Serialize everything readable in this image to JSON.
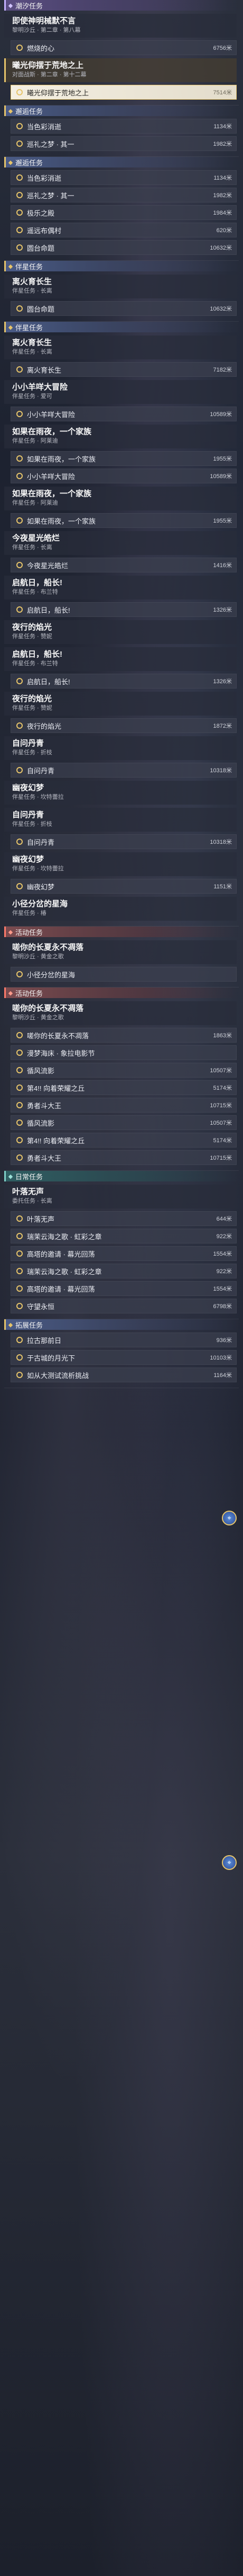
{
  "icons": {
    "category": "diamond-icon",
    "marker": "ring-marker-icon",
    "pin": "map-pin-icon"
  },
  "colors": {
    "accent": "#e6c46a",
    "current_step_bg": "#f4efe2",
    "highlight_cat": "#7b4b4f"
  },
  "sections": [
    {
      "category": "潮汐任务",
      "style": "story",
      "quests": [
        {
          "title": "即使神明械默不言",
          "sub": "黎明沙丘 · 第二章 · 第八幕",
          "tracked": false,
          "steps": [
            {
              "label": "燃烧的心",
              "dist": "6756米",
              "current": false
            }
          ]
        },
        {
          "title": "曦光仰摆于荒地之上",
          "sub": "对面战斯 · 第二章 · 第十二幕",
          "tracked": true,
          "steps": [
            {
              "label": "曦光仰摆于荒地之上",
              "dist": "7514米",
              "current": true
            }
          ]
        }
      ]
    },
    {
      "category": "邂逅任务",
      "style": "normal",
      "quests": [
        {
          "title": "",
          "sub": "",
          "tracked": false,
          "steps": [
            {
              "label": "当色彩消逝",
              "dist": "1134米",
              "current": false
            },
            {
              "label": "巡礼之梦 · 其一",
              "dist": "1982米",
              "current": false
            }
          ]
        }
      ]
    },
    {
      "category": "邂逅任务",
      "style": "normal",
      "quests": [
        {
          "title": "",
          "sub": "",
          "tracked": false,
          "steps": [
            {
              "label": "当色彩消逝",
              "dist": "1134米",
              "current": false
            },
            {
              "label": "巡礼之梦 · 其一",
              "dist": "1982米",
              "current": false
            },
            {
              "label": "极乐之殿",
              "dist": "1984米",
              "current": false
            },
            {
              "label": "遥远布偶村",
              "dist": "620米",
              "current": false
            },
            {
              "label": "圆台命题",
              "dist": "10632米",
              "current": false
            }
          ]
        }
      ]
    },
    {
      "category": "伴星任务",
      "style": "normal",
      "quests": [
        {
          "title": "离火育长生",
          "sub": "伴星任务 · 长离",
          "tracked": false,
          "steps": [
            {
              "label": "圆台命题",
              "dist": "10632米",
              "current": false
            }
          ]
        }
      ]
    },
    {
      "category": "伴星任务",
      "style": "normal",
      "quests": [
        {
          "title": "离火育长生",
          "sub": "伴星任务 · 长离",
          "tracked": false,
          "steps": [
            {
              "label": "离火育长生",
              "dist": "7182米",
              "current": false
            }
          ]
        },
        {
          "title": "小小羊咩大冒险",
          "sub": "伴星任务 · 爱可",
          "tracked": false,
          "steps": [
            {
              "label": "小小羊咩大冒险",
              "dist": "10589米",
              "current": false
            }
          ]
        },
        {
          "title": "如果在雨夜，一个家族",
          "sub": "伴星任务 · 阿莱迪",
          "tracked": false,
          "steps": [
            {
              "label": "如果在雨夜，一个家族",
              "dist": "1955米",
              "current": false
            },
            {
              "label": "小小羊咩大冒险",
              "dist": "10589米",
              "current": false
            }
          ]
        },
        {
          "title": "如果在雨夜，一个家族",
          "sub": "伴星任务 · 阿莱迪",
          "tracked": false,
          "steps": [
            {
              "label": "如果在雨夜，一个家族",
              "dist": "1955米",
              "current": false
            }
          ]
        },
        {
          "title": "今夜星光皓烂",
          "sub": "伴星任务 · 长离",
          "tracked": false,
          "steps": [
            {
              "label": "今夜星光皓烂",
              "dist": "1416米",
              "current": false
            }
          ]
        },
        {
          "title": "启航日，船长!",
          "sub": "伴星任务 · 布兰特",
          "tracked": false,
          "steps": [
            {
              "label": "启航日，船长!",
              "dist": "1326米",
              "current": false
            }
          ]
        },
        {
          "title": "夜行的焰光",
          "sub": "伴星任务 · 赞妮",
          "tracked": false,
          "steps": []
        },
        {
          "title": "启航日，船长!",
          "sub": "伴星任务 · 布兰特",
          "tracked": false,
          "steps": [
            {
              "label": "启航日，船长!",
              "dist": "1326米",
              "current": false
            }
          ]
        },
        {
          "title": "夜行的焰光",
          "sub": "伴星任务 · 赞妮",
          "tracked": false,
          "steps": [
            {
              "label": "夜行的焰光",
              "dist": "1872米",
              "current": false
            }
          ]
        },
        {
          "title": "自问丹青",
          "sub": "伴星任务 · 折枝",
          "tracked": false,
          "steps": [
            {
              "label": "自问丹青",
              "dist": "10318米",
              "current": false
            }
          ]
        },
        {
          "title": "幽夜幻梦",
          "sub": "伴星任务 · 坎特蕾拉",
          "tracked": false,
          "steps": []
        },
        {
          "title": "自问丹青",
          "sub": "伴星任务 · 折枝",
          "tracked": false,
          "steps": [
            {
              "label": "自问丹青",
              "dist": "10318米",
              "current": false
            }
          ]
        },
        {
          "title": "幽夜幻梦",
          "sub": "伴星任务 · 坎特蕾拉",
          "tracked": false,
          "steps": [
            {
              "label": "幽夜幻梦",
              "dist": "1151米",
              "current": false
            }
          ]
        },
        {
          "title": "小径分岔的星海",
          "sub": "伴星任务 · 椿",
          "tracked": false,
          "steps": []
        }
      ]
    },
    {
      "category": "活动任务",
      "style": "active",
      "quests": [
        {
          "title": "嗟你的长夏永不凋落",
          "sub": "黎明沙丘 · 黄金之歌",
          "tracked": false,
          "steps": [
            {
              "label": "小径分岔的星海",
              "dist": "",
              "current": false
            }
          ]
        }
      ]
    },
    {
      "category": "活动任务",
      "style": "active",
      "quests": [
        {
          "title": "嗟你的长夏永不凋落",
          "sub": "黎明沙丘 · 黄金之歌",
          "tracked": false,
          "steps": [
            {
              "label": "嗟你的长夏永不凋落",
              "dist": "1863米",
              "current": false
            },
            {
              "label": "漫梦海床 · 象拉电影节",
              "dist": "",
              "current": false
            },
            {
              "label": "循风流影",
              "dist": "10507米",
              "current": false
            },
            {
              "label": "第4!! 向着荣耀之丘",
              "dist": "5174米",
              "current": false
            },
            {
              "label": "勇者斗大王",
              "dist": "10715米",
              "current": false
            },
            {
              "label": "循风流影",
              "dist": "10507米",
              "current": false
            },
            {
              "label": "第4!! 向着荣耀之丘",
              "dist": "5174米",
              "current": false
            },
            {
              "label": "勇者斗大王",
              "dist": "10715米",
              "current": false
            }
          ]
        }
      ]
    },
    {
      "category": "日常任务",
      "style": "daily",
      "quests": [
        {
          "title": "叶落无声",
          "sub": "委托任务 · 长离",
          "tracked": false,
          "steps": [
            {
              "label": "叶落无声",
              "dist": "644米",
              "current": false
            },
            {
              "label": "瑞茉云海之歌 · 虹彩之章",
              "dist": "922米",
              "current": false
            },
            {
              "label": "高塔的邀请 · 幕光回荡",
              "dist": "1554米",
              "current": false
            },
            {
              "label": "瑞茉云海之歌 · 虹彩之章",
              "dist": "922米",
              "current": false
            },
            {
              "label": "高塔的邀请 · 幕光回荡",
              "dist": "1554米",
              "current": false
            },
            {
              "label": "守望永恒",
              "dist": "6798米",
              "current": false
            }
          ]
        }
      ]
    },
    {
      "category": "拓展任务",
      "style": "normal",
      "quests": [
        {
          "title": "",
          "sub": "",
          "tracked": false,
          "steps": [
            {
              "label": "拉古那前日",
              "dist": "936米",
              "current": false
            },
            {
              "label": "于古城的月光下",
              "dist": "10103米",
              "current": false
            },
            {
              "label": "如从大测试流析挑战",
              "dist": "1164米",
              "current": false
            }
          ]
        }
      ]
    }
  ]
}
